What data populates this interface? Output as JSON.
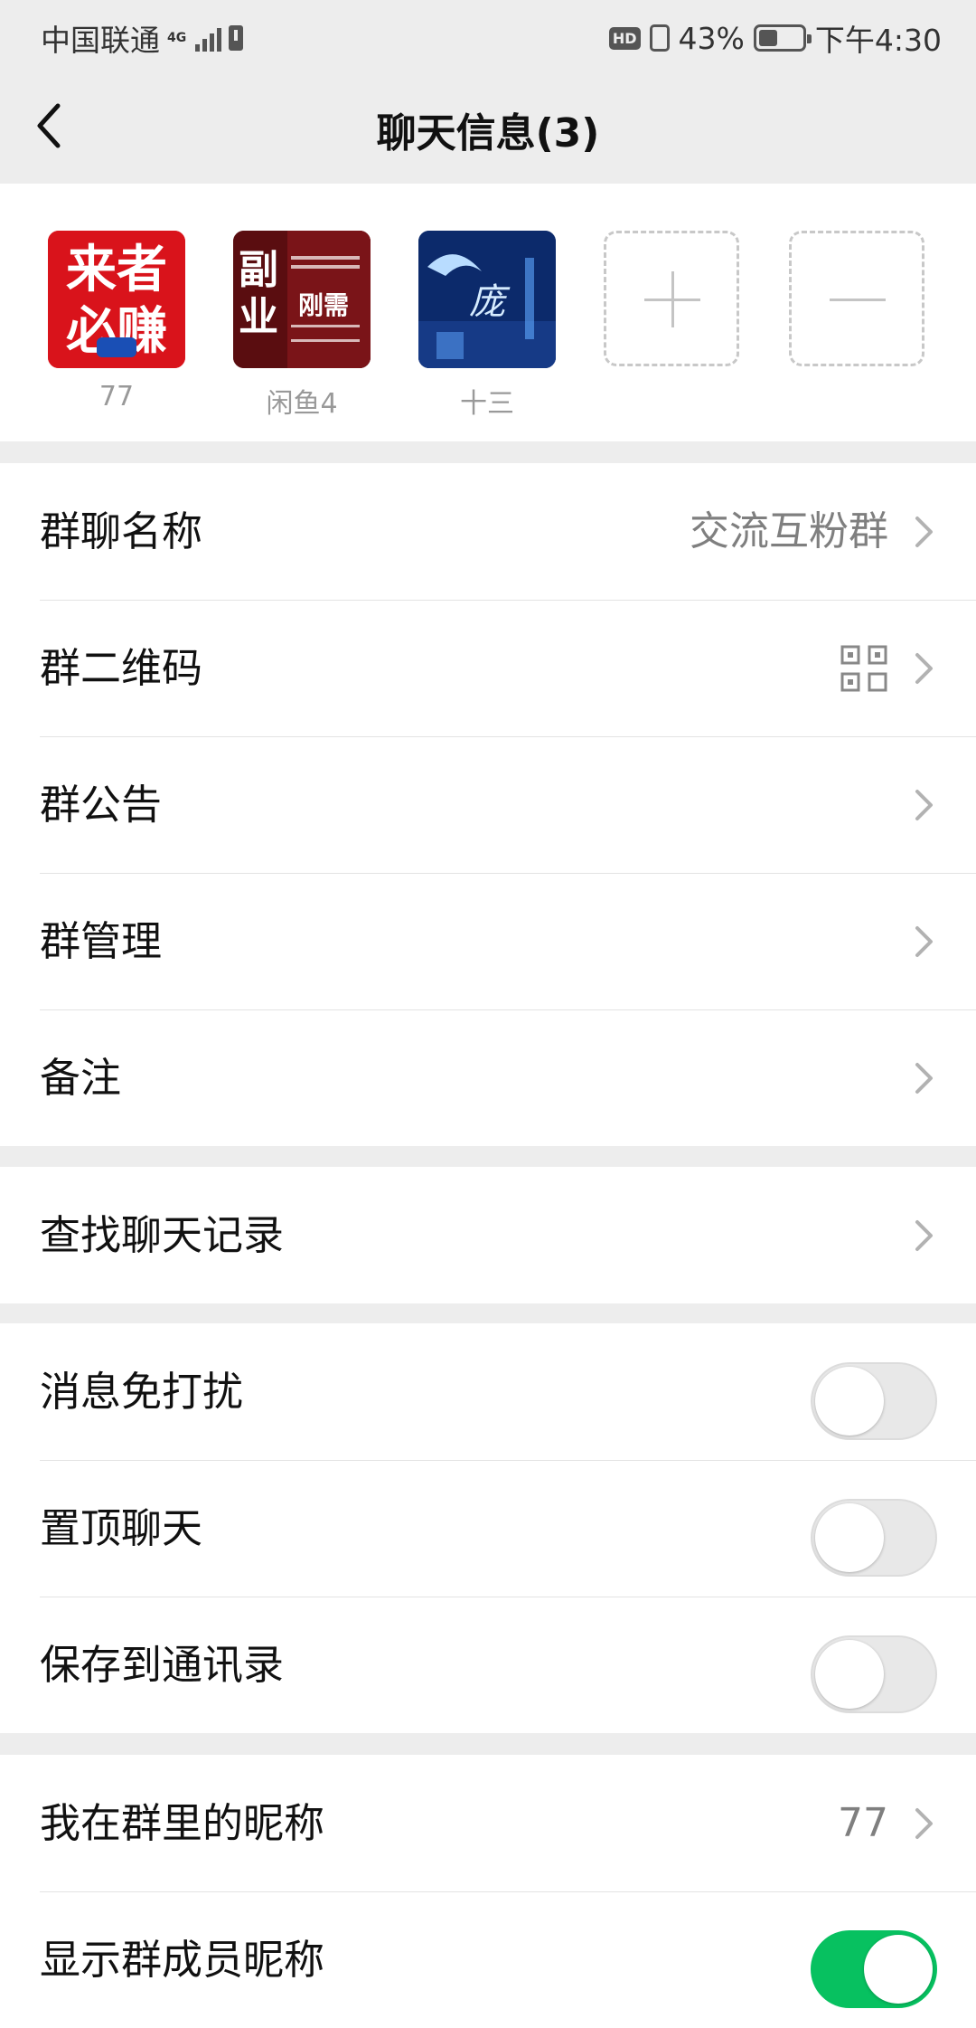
{
  "status_bar": {
    "carrier": "中国联通",
    "network": "4G",
    "battery_percent": "43%",
    "battery_level": 0.43,
    "time": "下午4:30",
    "hd": "HD"
  },
  "nav": {
    "title": "聊天信息(3)",
    "back_icon": "chevron-left-icon"
  },
  "members": [
    {
      "name": "77",
      "avatar_text_1": "来者",
      "avatar_text_2": "必赚",
      "avatar_colors": [
        "#d9131b",
        "#ffffff"
      ]
    },
    {
      "name": "闲鱼4",
      "avatar_text_1": "副",
      "avatar_text_2": "业",
      "avatar_text_3": "刚需",
      "avatar_colors": [
        "#5a0d10",
        "#ffffff"
      ]
    },
    {
      "name": "十三",
      "avatar_text_1": "庞",
      "avatar_colors": [
        "#0c2a6b",
        "#9fd3ff"
      ]
    }
  ],
  "member_actions": {
    "add_icon": "plus-icon",
    "remove_icon": "minus-icon"
  },
  "group_info": {
    "name_label": "群聊名称",
    "name_value": "交流互粉群",
    "qr_label": "群二维码",
    "notice_label": "群公告",
    "manage_label": "群管理",
    "remark_label": "备注"
  },
  "search": {
    "label": "查找聊天记录"
  },
  "settings": {
    "mute_label": "消息免打扰",
    "mute_on": false,
    "pin_label": "置顶聊天",
    "pin_on": false,
    "save_contacts_label": "保存到通讯录",
    "save_contacts_on": false
  },
  "nickname": {
    "my_nickname_label": "我在群里的昵称",
    "my_nickname_value": "77",
    "show_member_nick_label": "显示群成员昵称",
    "show_member_nick_on": true
  },
  "colors": {
    "background": "#ededed",
    "accent_green": "#07c160",
    "secondary_text": "#7f7f7f"
  }
}
